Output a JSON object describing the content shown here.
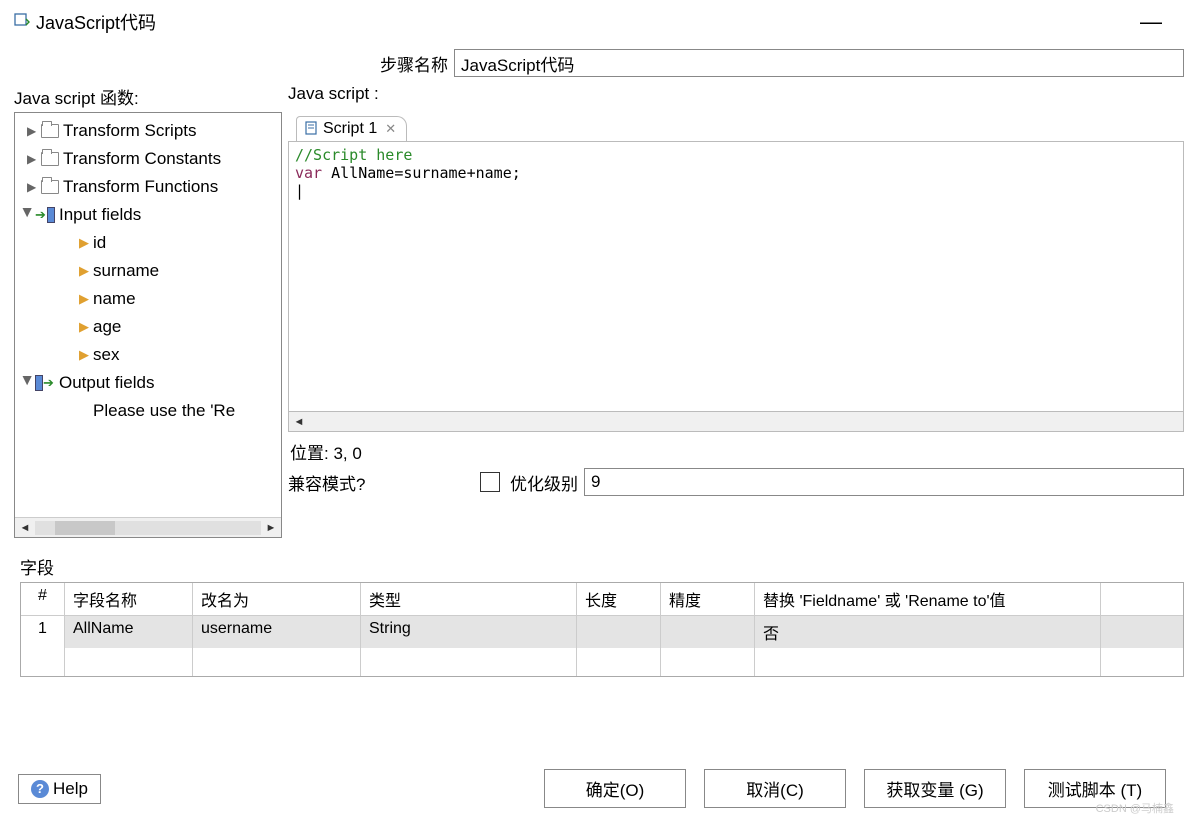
{
  "window": {
    "title": "JavaScript代码"
  },
  "step": {
    "label": "步骤名称",
    "value": "JavaScript代码"
  },
  "leftPanel": {
    "title": "Java script 函数:",
    "tree": {
      "transformScripts": "Transform Scripts",
      "transformConstants": "Transform Constants",
      "transformFunctions": "Transform Functions",
      "inputFields": "Input fields",
      "fields": [
        "id",
        "surname",
        "name",
        "age",
        "sex"
      ],
      "outputFields": "Output fields",
      "outputHint": "Please use the 'Re"
    }
  },
  "rightPanel": {
    "title": "Java script :",
    "tab": "Script 1",
    "code": {
      "comment": "//Script here",
      "kw": "var",
      "rest": " AllName=surname+name;"
    },
    "position": "位置: 3, 0",
    "compatLabel": "兼容模式?",
    "optLabel": "优化级别",
    "optValue": "9"
  },
  "fieldsSection": {
    "title": "字段",
    "headers": {
      "num": "#",
      "name": "字段名称",
      "rename": "改名为",
      "type": "类型",
      "len": "长度",
      "prec": "精度",
      "repl": "替换 'Fieldname' 或 'Rename to'值"
    },
    "rows": [
      {
        "num": "1",
        "name": "AllName",
        "rename": "username",
        "type": "String",
        "len": "",
        "prec": "",
        "repl": "否"
      }
    ]
  },
  "footer": {
    "help": "Help",
    "ok": "确定(O)",
    "cancel": "取消(C)",
    "getvars": "获取变量 (G)",
    "test": "测试脚本 (T)"
  },
  "watermark": "CSDN @马楠鑫"
}
